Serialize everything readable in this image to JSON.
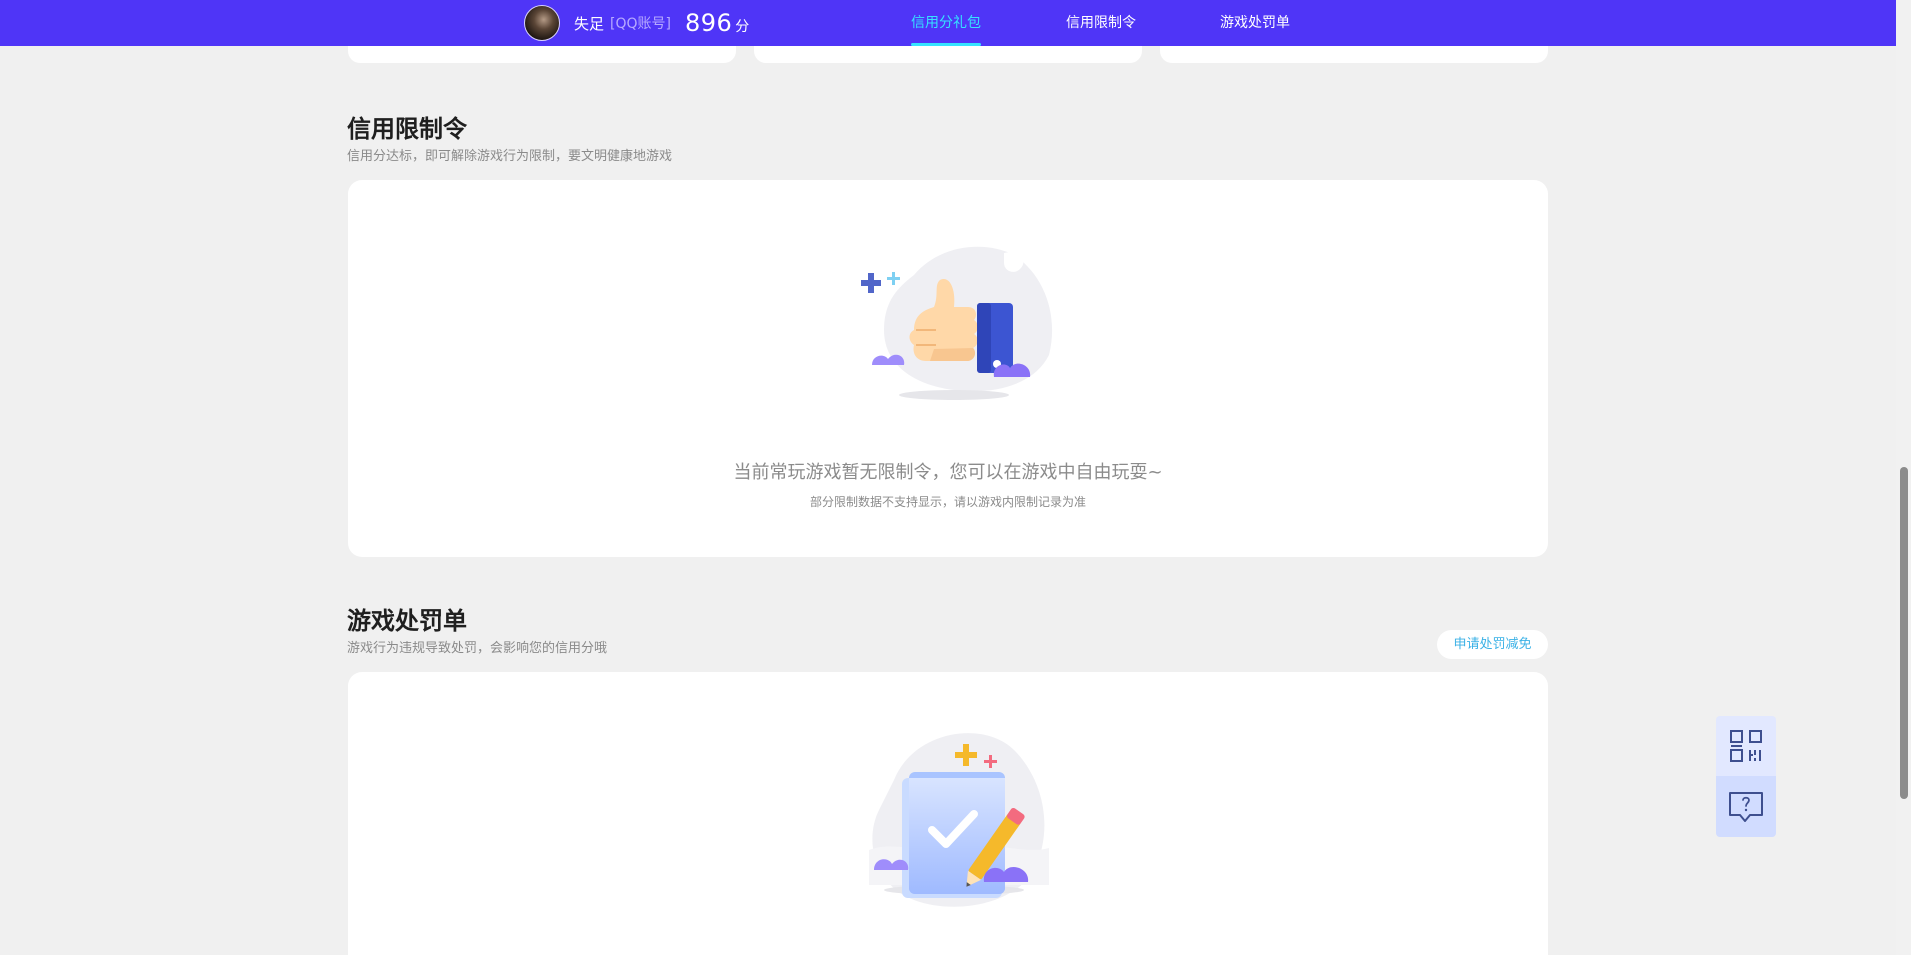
{
  "header": {
    "user_name": "失足",
    "account_type": "[QQ账号]",
    "score": "896",
    "score_unit": "分",
    "nav": [
      {
        "label": "信用分礼包",
        "active": true
      },
      {
        "label": "信用限制令",
        "active": false
      },
      {
        "label": "游戏处罚单",
        "active": false
      }
    ]
  },
  "restriction": {
    "title": "信用限制令",
    "desc": "信用分达标，即可解除游戏行为限制，要文明健康地游戏",
    "empty_main": "当前常玩游戏暂无限制令，您可以在游戏中自由玩耍~",
    "empty_sub": "部分限制数据不支持显示，请以游戏内限制记录为准"
  },
  "penalty": {
    "title": "游戏处罚单",
    "desc": "游戏行为违规导致处罚，会影响您的信用分哦",
    "apply_button": "申请处罚减免"
  },
  "side_tools": {
    "qr_icon": "qrcode-icon",
    "help_icon": "help-chat-icon"
  },
  "colors": {
    "header_bg": "#4f35f7",
    "active_nav": "#35e3ff",
    "accent_link": "#3ab1e6",
    "page_bg": "#f0f0f0"
  }
}
